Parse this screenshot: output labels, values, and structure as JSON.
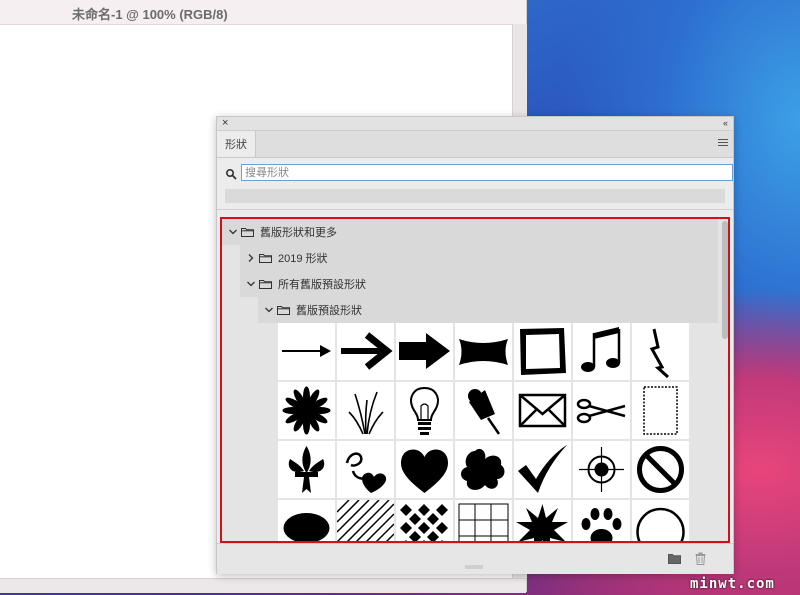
{
  "document": {
    "title": "未命名-1 @ 100% (RGB/8)"
  },
  "panel": {
    "close_glyph": "×",
    "collapse_glyph": "‹‹",
    "tab_label": "形狀",
    "search_placeholder": "搜尋形狀",
    "tree": {
      "root": {
        "label": "舊版形狀和更多"
      },
      "child_2019": {
        "label": "2019 形狀"
      },
      "child_all_legacy": {
        "label": "所有舊版預設形狀"
      },
      "child_legacy_default": {
        "label": "舊版預設形狀"
      }
    },
    "shapes": [
      "thin-arrow-icon",
      "bold-arrow-icon",
      "block-arrow-icon",
      "banner-icon",
      "rough-frame-icon",
      "music-note-icon",
      "lightning-icon",
      "starburst-flower-icon",
      "grass-icon",
      "lightbulb-icon",
      "pushpin-icon",
      "envelope-icon",
      "scissors-icon",
      "stamp-frame-icon",
      "fleur-de-lis-icon",
      "leaf-heart-icon",
      "heart-icon",
      "splat-icon",
      "checkmark-icon",
      "crosshair-icon",
      "no-sign-icon",
      "ellipse-icon",
      "hatch-pattern-icon",
      "diamond-pattern-icon",
      "grid-pattern-icon",
      "burst-icon",
      "paw-print-icon",
      "circle-frame-icon"
    ],
    "bottom": {
      "new_folder_icon": "folder-icon",
      "delete_icon": "trash-icon"
    }
  },
  "watermark": "minwt.com"
}
